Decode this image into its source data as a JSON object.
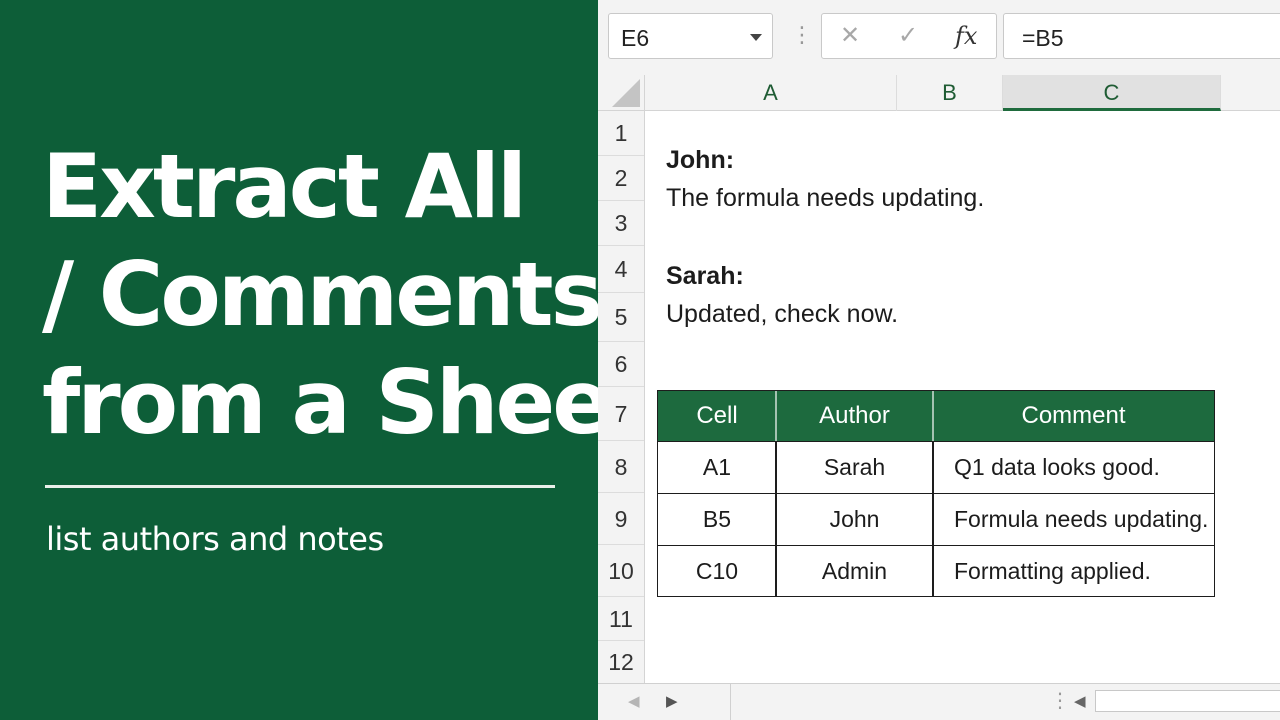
{
  "hero": {
    "title_lines": [
      "Extract All",
      "/ Comments /",
      "from a Sheet"
    ],
    "subtitle": "list authors and notes"
  },
  "formula_bar": {
    "name_box": "E6",
    "cancel_glyph": "✕",
    "confirm_glyph": "✓",
    "fx_label": "fx",
    "formula": "=B5",
    "dots": "⋮"
  },
  "columns": [
    "A",
    "B",
    "C"
  ],
  "rows": [
    "1",
    "2",
    "3",
    "4",
    "5",
    "6",
    "7",
    "8",
    "9",
    "10",
    "11",
    "12"
  ],
  "cells": {
    "john_author": "John:",
    "john_comment": "The formula needs updating.",
    "sarah_author": "Sarah:",
    "sarah_comment": "Updated, check now."
  },
  "comments_table": {
    "headers": [
      "Cell",
      "Author",
      "Comment"
    ],
    "rows": [
      [
        "A1",
        "Sarah",
        "Q1 data looks good."
      ],
      [
        "B5",
        "John",
        "Formula needs updating."
      ],
      [
        "C10",
        "Admin",
        "Formatting applied."
      ]
    ]
  },
  "bottom_bar": {
    "prev_glyph": "◀",
    "next_glyph": "▶",
    "dots": "⋮",
    "scroll_left_glyph": "◀"
  },
  "colors": {
    "panel_green": "#0d5e38",
    "table_header_green": "#1d6a3e"
  }
}
